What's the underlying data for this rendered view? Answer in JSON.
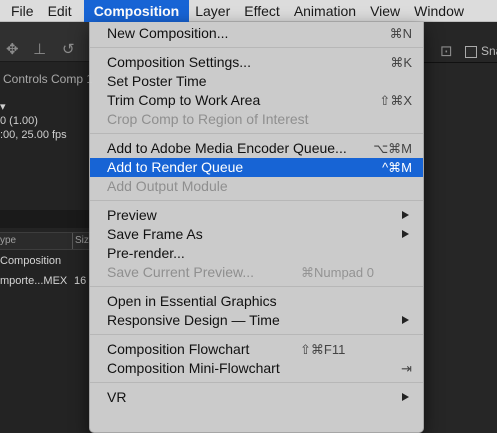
{
  "menubar": {
    "items": [
      "File",
      "Edit",
      "Composition",
      "Layer",
      "Effect",
      "Animation",
      "View",
      "Window"
    ],
    "active": "Composition"
  },
  "background": {
    "panel_title": "Controls  Comp 1",
    "info_line1": "▾",
    "info_line2": "0 (1.00)",
    "info_line3": ":00, 25.00 fps",
    "col_type": "ype",
    "col_size": "Siz",
    "row1": "Composition",
    "row2_name": "mporte...MEX",
    "row2_size": "16",
    "snap_label": "Sna"
  },
  "menu": {
    "items": [
      {
        "label": "New Composition...",
        "shortcut": "⌘N"
      },
      "sep",
      {
        "label": "Composition Settings...",
        "shortcut": "⌘K"
      },
      {
        "label": "Set Poster Time",
        "shortcut": ""
      },
      {
        "label": "Trim Comp to Work Area",
        "shortcut": "⇧⌘X"
      },
      {
        "label": "Crop Comp to Region of Interest",
        "shortcut": "",
        "disabled": true
      },
      "sep",
      {
        "label": "Add to Adobe Media Encoder Queue...",
        "shortcut": "⌥⌘M"
      },
      {
        "label": "Add to Render Queue",
        "shortcut": "^⌘M",
        "highlighted": true
      },
      {
        "label": "Add Output Module",
        "shortcut": "",
        "disabled": true
      },
      "sep",
      {
        "label": "Preview",
        "submenu": true
      },
      {
        "label": "Save Frame As",
        "submenu": true
      },
      {
        "label": "Pre-render...",
        "shortcut": ""
      },
      {
        "label": "Save Current Preview...",
        "shortcut": "⌘Numpad 0",
        "disabled": true
      },
      "sep",
      {
        "label": "Open in Essential Graphics",
        "shortcut": ""
      },
      {
        "label": "Responsive Design — Time",
        "submenu": true
      },
      "sep",
      {
        "label": "Composition Flowchart",
        "shortcut": "⇧⌘F11"
      },
      {
        "label": "Composition Mini-Flowchart",
        "shortcut": "⇥"
      },
      "sep",
      {
        "label": "VR",
        "submenu": true
      }
    ]
  }
}
